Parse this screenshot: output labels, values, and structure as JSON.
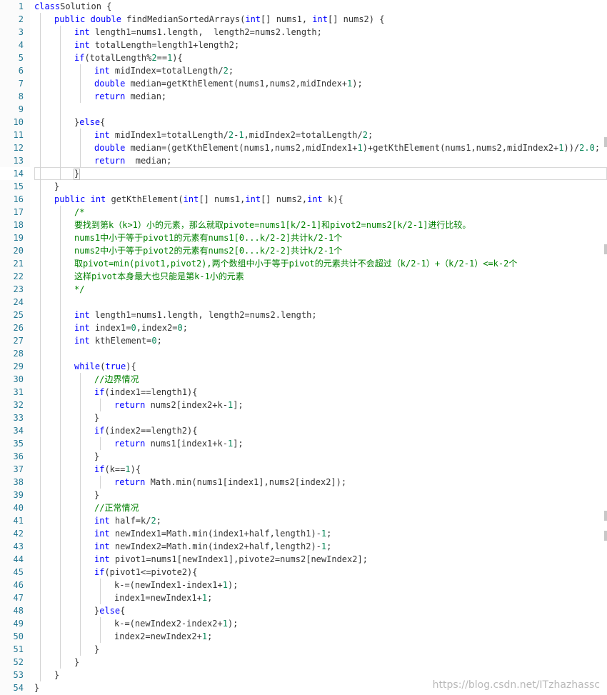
{
  "editor": {
    "language": "java",
    "current_line": 14,
    "lines": [
      {
        "n": "1",
        "indent": 0,
        "tokens": [
          [
            "kw",
            "class"
          ],
          [
            "",
            ""
          ],
          [
            "",
            "Solution {"
          ]
        ]
      },
      {
        "n": "2",
        "indent": 1,
        "tokens": [
          [
            "kw",
            "public"
          ],
          [
            "",
            " "
          ],
          [
            "kw",
            "double"
          ],
          [
            "",
            " findMedianSortedArrays("
          ],
          [
            "kw",
            "int"
          ],
          [
            "",
            "[] nums1, "
          ],
          [
            "kw",
            "int"
          ],
          [
            "",
            "[] nums2) {"
          ]
        ]
      },
      {
        "n": "3",
        "indent": 2,
        "tokens": [
          [
            "kw",
            "int"
          ],
          [
            "",
            " length1=nums1.length,  length2=nums2.length;"
          ]
        ]
      },
      {
        "n": "4",
        "indent": 2,
        "tokens": [
          [
            "kw",
            "int"
          ],
          [
            "",
            " totalLength=length1+length2;"
          ]
        ]
      },
      {
        "n": "5",
        "indent": 2,
        "tokens": [
          [
            "kw",
            "if"
          ],
          [
            "",
            "(totalLength%"
          ],
          [
            "n",
            "2"
          ],
          [
            "",
            "=="
          ],
          [
            "n",
            "1"
          ],
          [
            "",
            "){"
          ]
        ]
      },
      {
        "n": "6",
        "indent": 3,
        "tokens": [
          [
            "kw",
            "int"
          ],
          [
            "",
            " midIndex=totalLength/"
          ],
          [
            "n",
            "2"
          ],
          [
            "",
            ";"
          ]
        ]
      },
      {
        "n": "7",
        "indent": 3,
        "tokens": [
          [
            "kw",
            "double"
          ],
          [
            "",
            " median=getKthElement(nums1,nums2,midIndex+"
          ],
          [
            "n",
            "1"
          ],
          [
            "",
            ");"
          ]
        ]
      },
      {
        "n": "8",
        "indent": 3,
        "tokens": [
          [
            "kw",
            "return"
          ],
          [
            "",
            " median;"
          ]
        ]
      },
      {
        "n": "9",
        "indent": 2,
        "tokens": []
      },
      {
        "n": "10",
        "indent": 2,
        "tokens": [
          [
            "",
            "}"
          ],
          [
            "kw",
            "else"
          ],
          [
            "",
            "{"
          ]
        ]
      },
      {
        "n": "11",
        "indent": 3,
        "tokens": [
          [
            "kw",
            "int"
          ],
          [
            "",
            " midIndex1=totalLength/"
          ],
          [
            "n",
            "2"
          ],
          [
            "",
            "-"
          ],
          [
            "n",
            "1"
          ],
          [
            "",
            ",midIndex2=totalLength/"
          ],
          [
            "n",
            "2"
          ],
          [
            "",
            ";"
          ]
        ]
      },
      {
        "n": "12",
        "indent": 3,
        "tokens": [
          [
            "kw",
            "double"
          ],
          [
            "",
            " median=(getKthElement(nums1,nums2,midIndex1+"
          ],
          [
            "n",
            "1"
          ],
          [
            "",
            ")+getKthElement(nums1,nums2,midIndex2+"
          ],
          [
            "n",
            "1"
          ],
          [
            "",
            "))/"
          ],
          [
            "n",
            "2.0"
          ],
          [
            "",
            ";"
          ]
        ]
      },
      {
        "n": "13",
        "indent": 3,
        "tokens": [
          [
            "kw",
            "return"
          ],
          [
            "",
            "  median;"
          ]
        ]
      },
      {
        "n": "14",
        "indent": 2,
        "tokens": [
          [
            "",
            "}"
          ]
        ]
      },
      {
        "n": "15",
        "indent": 1,
        "tokens": [
          [
            "",
            "}"
          ]
        ]
      },
      {
        "n": "16",
        "indent": 1,
        "tokens": [
          [
            "kw",
            "public"
          ],
          [
            "",
            " "
          ],
          [
            "kw",
            "int"
          ],
          [
            "",
            " getKthElement("
          ],
          [
            "kw",
            "int"
          ],
          [
            "",
            "[] nums1,"
          ],
          [
            "kw",
            "int"
          ],
          [
            "",
            "[] nums2,"
          ],
          [
            "kw",
            "int"
          ],
          [
            "",
            " k){"
          ]
        ]
      },
      {
        "n": "17",
        "indent": 2,
        "tokens": [
          [
            "cm",
            "/*"
          ]
        ]
      },
      {
        "n": "18",
        "indent": 2,
        "tokens": [
          [
            "cm",
            "要找到第k（k>1）小的元素，那么就取pivote=nums1[k/2-1]和pivot2=nums2[k/2-1]进行比较。"
          ]
        ]
      },
      {
        "n": "19",
        "indent": 2,
        "tokens": [
          [
            "cm",
            "nums1中小于等于pivot1的元素有nums1[0...k/2-2]共计k/2-1个"
          ]
        ]
      },
      {
        "n": "20",
        "indent": 2,
        "tokens": [
          [
            "cm",
            "nums2中小于等于pivot2的元素有nums2[0...k/2-2]共计k/2-1个"
          ]
        ]
      },
      {
        "n": "21",
        "indent": 2,
        "tokens": [
          [
            "cm",
            "取pivot=min(pivot1,pivot2),两个数组中小于等于pivot的元素共计不会超过（k/2-1）+（k/2-1）<=k-2个"
          ]
        ]
      },
      {
        "n": "22",
        "indent": 2,
        "tokens": [
          [
            "cm",
            "这样pivot本身最大也只能是第k-1小的元素"
          ]
        ]
      },
      {
        "n": "23",
        "indent": 2,
        "tokens": [
          [
            "cm",
            "*/"
          ]
        ]
      },
      {
        "n": "24",
        "indent": 2,
        "tokens": []
      },
      {
        "n": "25",
        "indent": 2,
        "tokens": [
          [
            "kw",
            "int"
          ],
          [
            "",
            " length1=nums1.length, length2=nums2.length;"
          ]
        ]
      },
      {
        "n": "26",
        "indent": 2,
        "tokens": [
          [
            "kw",
            "int"
          ],
          [
            "",
            " index1="
          ],
          [
            "n",
            "0"
          ],
          [
            "",
            ",index2="
          ],
          [
            "n",
            "0"
          ],
          [
            "",
            ";"
          ]
        ]
      },
      {
        "n": "27",
        "indent": 2,
        "tokens": [
          [
            "kw",
            "int"
          ],
          [
            "",
            " kthElement="
          ],
          [
            "n",
            "0"
          ],
          [
            "",
            ";"
          ]
        ]
      },
      {
        "n": "28",
        "indent": 2,
        "tokens": []
      },
      {
        "n": "29",
        "indent": 2,
        "tokens": [
          [
            "kw",
            "while"
          ],
          [
            "",
            "("
          ],
          [
            "kw",
            "true"
          ],
          [
            "",
            "){"
          ]
        ]
      },
      {
        "n": "30",
        "indent": 3,
        "tokens": [
          [
            "cm",
            "//边界情况"
          ]
        ]
      },
      {
        "n": "31",
        "indent": 3,
        "tokens": [
          [
            "kw",
            "if"
          ],
          [
            "",
            "(index1==length1){"
          ]
        ]
      },
      {
        "n": "32",
        "indent": 4,
        "tokens": [
          [
            "kw",
            "return"
          ],
          [
            "",
            " nums2[index2+k-"
          ],
          [
            "n",
            "1"
          ],
          [
            "",
            "];"
          ]
        ]
      },
      {
        "n": "33",
        "indent": 3,
        "tokens": [
          [
            "",
            "}"
          ]
        ]
      },
      {
        "n": "34",
        "indent": 3,
        "tokens": [
          [
            "kw",
            "if"
          ],
          [
            "",
            "(index2==length2){"
          ]
        ]
      },
      {
        "n": "35",
        "indent": 4,
        "tokens": [
          [
            "kw",
            "return"
          ],
          [
            "",
            " nums1[index1+k-"
          ],
          [
            "n",
            "1"
          ],
          [
            "",
            "];"
          ]
        ]
      },
      {
        "n": "36",
        "indent": 3,
        "tokens": [
          [
            "",
            "}"
          ]
        ]
      },
      {
        "n": "37",
        "indent": 3,
        "tokens": [
          [
            "kw",
            "if"
          ],
          [
            "",
            "(k=="
          ],
          [
            "n",
            "1"
          ],
          [
            "",
            "){"
          ]
        ]
      },
      {
        "n": "38",
        "indent": 4,
        "tokens": [
          [
            "kw",
            "return"
          ],
          [
            "",
            " Math.min(nums1[index1],nums2[index2]);"
          ]
        ]
      },
      {
        "n": "39",
        "indent": 3,
        "tokens": [
          [
            "",
            "}"
          ]
        ]
      },
      {
        "n": "40",
        "indent": 3,
        "tokens": [
          [
            "cm",
            "//正常情况"
          ]
        ]
      },
      {
        "n": "41",
        "indent": 3,
        "tokens": [
          [
            "kw",
            "int"
          ],
          [
            "",
            " half=k/"
          ],
          [
            "n",
            "2"
          ],
          [
            "",
            ";"
          ]
        ]
      },
      {
        "n": "42",
        "indent": 3,
        "tokens": [
          [
            "kw",
            "int"
          ],
          [
            "",
            " newIndex1=Math.min(index1+half,length1)-"
          ],
          [
            "n",
            "1"
          ],
          [
            "",
            ";"
          ]
        ]
      },
      {
        "n": "43",
        "indent": 3,
        "tokens": [
          [
            "kw",
            "int"
          ],
          [
            "",
            " newIndex2=Math.min(index2+half,length2)-"
          ],
          [
            "n",
            "1"
          ],
          [
            "",
            ";"
          ]
        ]
      },
      {
        "n": "44",
        "indent": 3,
        "tokens": [
          [
            "kw",
            "int"
          ],
          [
            "",
            " pivot1=nums1[newIndex1],pivote2=nums2[newIndex2];"
          ]
        ]
      },
      {
        "n": "45",
        "indent": 3,
        "tokens": [
          [
            "kw",
            "if"
          ],
          [
            "",
            "(pivot1<=pivote2){"
          ]
        ]
      },
      {
        "n": "46",
        "indent": 4,
        "tokens": [
          [
            "",
            "k-=(newIndex1-index1+"
          ],
          [
            "n",
            "1"
          ],
          [
            "",
            ");"
          ]
        ]
      },
      {
        "n": "47",
        "indent": 4,
        "tokens": [
          [
            "",
            "index1=newIndex1+"
          ],
          [
            "n",
            "1"
          ],
          [
            "",
            ";"
          ]
        ]
      },
      {
        "n": "48",
        "indent": 3,
        "tokens": [
          [
            "",
            "}"
          ],
          [
            "kw",
            "else"
          ],
          [
            "",
            "{"
          ]
        ]
      },
      {
        "n": "49",
        "indent": 4,
        "tokens": [
          [
            "",
            "k-=(newIndex2-index2+"
          ],
          [
            "n",
            "1"
          ],
          [
            "",
            ");"
          ]
        ]
      },
      {
        "n": "50",
        "indent": 4,
        "tokens": [
          [
            "",
            "index2=newIndex2+"
          ],
          [
            "n",
            "1"
          ],
          [
            "",
            ";"
          ]
        ]
      },
      {
        "n": "51",
        "indent": 3,
        "tokens": [
          [
            "",
            "}"
          ]
        ]
      },
      {
        "n": "52",
        "indent": 2,
        "tokens": [
          [
            "",
            "}"
          ]
        ]
      },
      {
        "n": "53",
        "indent": 1,
        "tokens": [
          [
            "",
            "}"
          ]
        ]
      },
      {
        "n": "54",
        "indent": 0,
        "tokens": [
          [
            "",
            "}"
          ]
        ]
      }
    ]
  },
  "watermark": "https://blog.csdn.net/ITzhazhassc"
}
